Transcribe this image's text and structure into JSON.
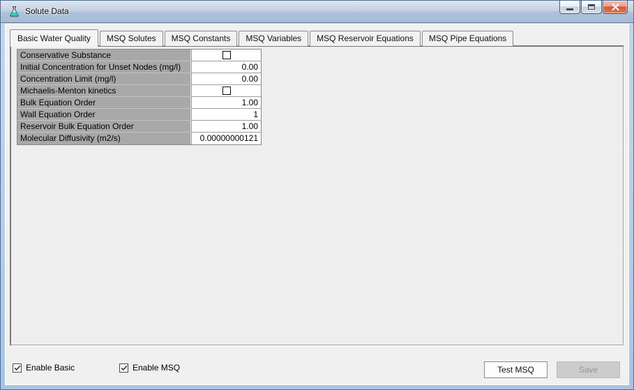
{
  "window": {
    "title": "Solute Data",
    "controls": {
      "minimize": "minimize",
      "maximize": "maximize",
      "close": "close"
    }
  },
  "tabs": [
    {
      "label": "Basic Water Quality",
      "active": true
    },
    {
      "label": "MSQ Solutes",
      "active": false
    },
    {
      "label": "MSQ Constants",
      "active": false
    },
    {
      "label": "MSQ Variables",
      "active": false
    },
    {
      "label": "MSQ Reservoir Equations",
      "active": false
    },
    {
      "label": "MSQ Pipe Equations",
      "active": false
    }
  ],
  "grid": {
    "rows": [
      {
        "label": "Conservative Substance",
        "type": "checkbox",
        "checked": false
      },
      {
        "label": "Initial Concentration for Unset Nodes (mg/l)",
        "type": "number",
        "value": "0.00"
      },
      {
        "label": "Concentration Limit (mg/l)",
        "type": "number",
        "value": "0.00"
      },
      {
        "label": "Michaelis-Menton kinetics",
        "type": "checkbox",
        "checked": false
      },
      {
        "label": "Bulk Equation Order",
        "type": "number",
        "value": "1.00"
      },
      {
        "label": "Wall Equation Order",
        "type": "number",
        "value": "1"
      },
      {
        "label": "Reservoir Bulk Equation Order",
        "type": "number",
        "value": "1.00"
      },
      {
        "label": "Molecular Diffusivity (m2/s)",
        "type": "number",
        "value": "0.00000000121"
      }
    ]
  },
  "footer": {
    "enable_basic_label": "Enable Basic",
    "enable_basic_checked": true,
    "enable_msq_label": "Enable MSQ",
    "enable_msq_checked": true,
    "test_msq_label": "Test MSQ",
    "save_label": "Save",
    "save_enabled": false
  },
  "colors": {
    "frame_blue": "#b7cde6",
    "titlebar_top": "#dde5f0",
    "close_red": "#d1583a",
    "dialog_bg": "#f0f0f0",
    "panel_bg": "#eeeeee",
    "grid_label_bg": "#a8a8a8",
    "disabled_text": "#959595"
  }
}
